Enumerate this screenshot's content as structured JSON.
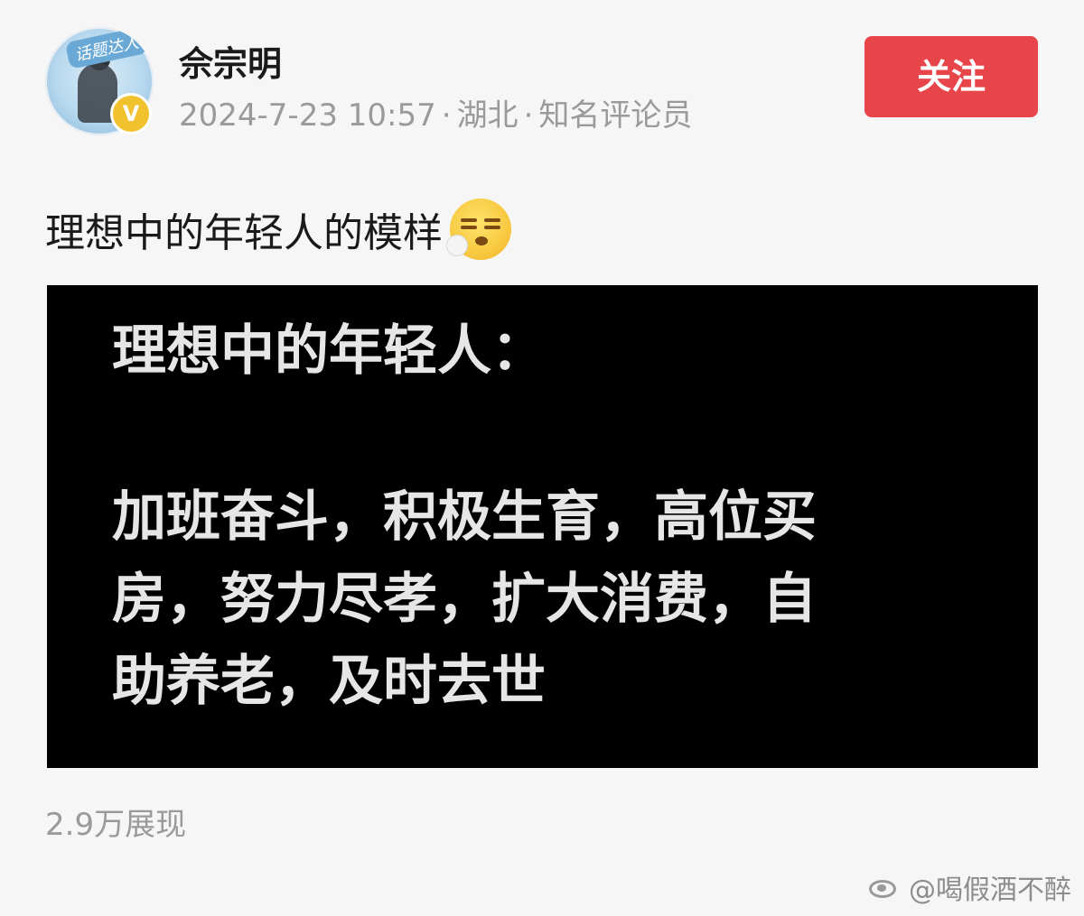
{
  "header": {
    "avatar_badge_text": "话题达人",
    "verified_mark": "V",
    "username": "佘宗明",
    "timestamp": "2024-7-23 10:57",
    "location": "湖北",
    "title": "知名评论员",
    "separator": "·",
    "follow_label": "关注"
  },
  "post": {
    "text": "理想中的年轻人的模样",
    "emoji": "sigh-face-emoji",
    "image": {
      "title": "理想中的年轻人：",
      "lines": [
        "加班奋斗，积极生育，高位买",
        "房，努力尽孝，扩大消费，自",
        "助养老，及时去世"
      ]
    },
    "views": "2.9万展现"
  },
  "watermark": {
    "text": "@喝假酒不醉"
  },
  "colors": {
    "follow_button": "#e8454a",
    "meta_text": "#9a9a9a",
    "card_background": "#000000",
    "card_text": "#e6e6e6"
  }
}
